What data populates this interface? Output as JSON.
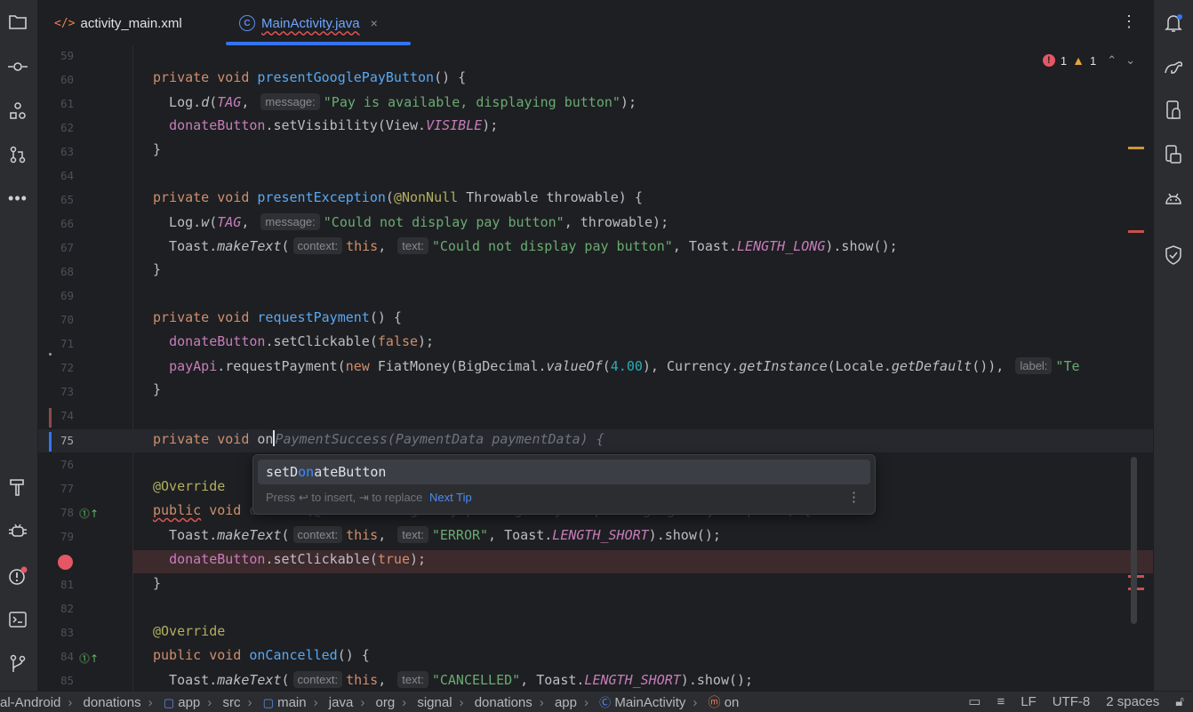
{
  "tabs": [
    {
      "label": "activity_main.xml",
      "icon": "xml-file-icon"
    },
    {
      "label": "MainActivity.java",
      "icon": "java-class-icon",
      "active": true,
      "close": "×"
    }
  ],
  "inspections": {
    "errors": "1",
    "warnings": "1"
  },
  "gutter": {
    "lines": [
      "59",
      "60",
      "61",
      "62",
      "63",
      "64",
      "65",
      "66",
      "67",
      "68",
      "69",
      "70",
      "71",
      "72",
      "73",
      "74",
      "75",
      "76",
      "77",
      "78",
      "79",
      "",
      "81",
      "82",
      "83",
      "84",
      "85"
    ],
    "current_line": "75"
  },
  "code": {
    "l60": {
      "a": "private void ",
      "b": "presentGooglePayButton",
      "c": "() {"
    },
    "l61": {
      "a": "  Log.",
      "b": "d",
      "c": "(",
      "d": "TAG",
      "e": ", ",
      "hint": "message:",
      "s": "\"Pay is available, displaying button\"",
      "f": ");"
    },
    "l62": {
      "a": "  ",
      "b": "donateButton",
      "c": ".setVisibility(View.",
      "d": "VISIBLE",
      "e": ");"
    },
    "l63": {
      "a": "}"
    },
    "l65": {
      "a": "private void ",
      "b": "presentException",
      "c": "(",
      "d": "@NonNull",
      "e": " Throwable throwable) {"
    },
    "l66": {
      "a": "  Log.",
      "b": "w",
      "c": "(",
      "d": "TAG",
      "e": ", ",
      "hint": "message:",
      "s": "\"Could not display pay button\"",
      "f": ", throwable);"
    },
    "l67": {
      "a": "  Toast.",
      "b": "makeText",
      "c": "(",
      "hint1": "context:",
      "d": "this",
      "e": ", ",
      "hint2": "text:",
      "s": "\"Could not display pay button\"",
      "f": ", Toast.",
      "g": "LENGTH_LONG",
      "h": ").show();"
    },
    "l68": {
      "a": "}"
    },
    "l70": {
      "a": "private void ",
      "b": "requestPayment",
      "c": "() {"
    },
    "l71": {
      "a": "  ",
      "b": "donateButton",
      "c": ".setClickable(",
      "d": "false",
      "e": ");"
    },
    "l72": {
      "a": "  ",
      "b": "payApi",
      "c": ".requestPayment(",
      "d": "new",
      "e": " FiatMoney(BigDecimal.",
      "f": "valueOf",
      "g": "(",
      "n": "4.00",
      "h": "), Currency.",
      "i": "getInstance",
      "j": "(Locale.",
      "k": "getDefault",
      "l": "()), ",
      "hint": "label:",
      "s": "\"Te"
    },
    "l73": {
      "a": "}"
    },
    "l75": {
      "a": "private void ",
      "b": "on",
      "ghost": "PaymentSuccess(PaymentData paymentData) {"
    },
    "l77": {
      "a": "@Override"
    },
    "l78": {
      "a": "public",
      "b": " void ",
      "ghost": "onError(@NonNull GooglePayApi.GooglePayException googlePayException) {"
    },
    "l79": {
      "a": "  Toast.",
      "b": "makeText",
      "c": "(",
      "hint1": "context:",
      "d": "this",
      "e": ", ",
      "hint2": "text:",
      "s": "\"ERROR\"",
      "f": ", Toast.",
      "g": "LENGTH_SHORT",
      "h": ").show();"
    },
    "l80": {
      "a": "  ",
      "b": "donateButton",
      "c": ".setClickable(",
      "d": "true",
      "e": ");"
    },
    "l81": {
      "a": "}"
    },
    "l83": {
      "a": "@Override"
    },
    "l84": {
      "a": "public void ",
      "b": "onCancelled",
      "c": "() {"
    },
    "l85": {
      "a": "  Toast.",
      "b": "makeText",
      "c": "(",
      "hint1": "context:",
      "d": "this",
      "e": ", ",
      "hint2": "text:",
      "s": "\"CANCELLED\"",
      "f": ", Toast.",
      "g": "LENGTH_SHORT",
      "h": ").show();"
    }
  },
  "completion": {
    "pre": "setD",
    "match": "on",
    "post": "ateButton",
    "hint": "Press ↩ to insert, ⇥ to replace",
    "tip": "Next Tip",
    "more": "⋮"
  },
  "breadcrumbs": [
    "al-Android",
    "donations",
    "app",
    "src",
    "main",
    "java",
    "org",
    "signal",
    "donations",
    "app",
    "MainActivity",
    "on"
  ],
  "status": {
    "line_sep": "LF",
    "encoding": "UTF-8",
    "indent": "2 spaces"
  }
}
